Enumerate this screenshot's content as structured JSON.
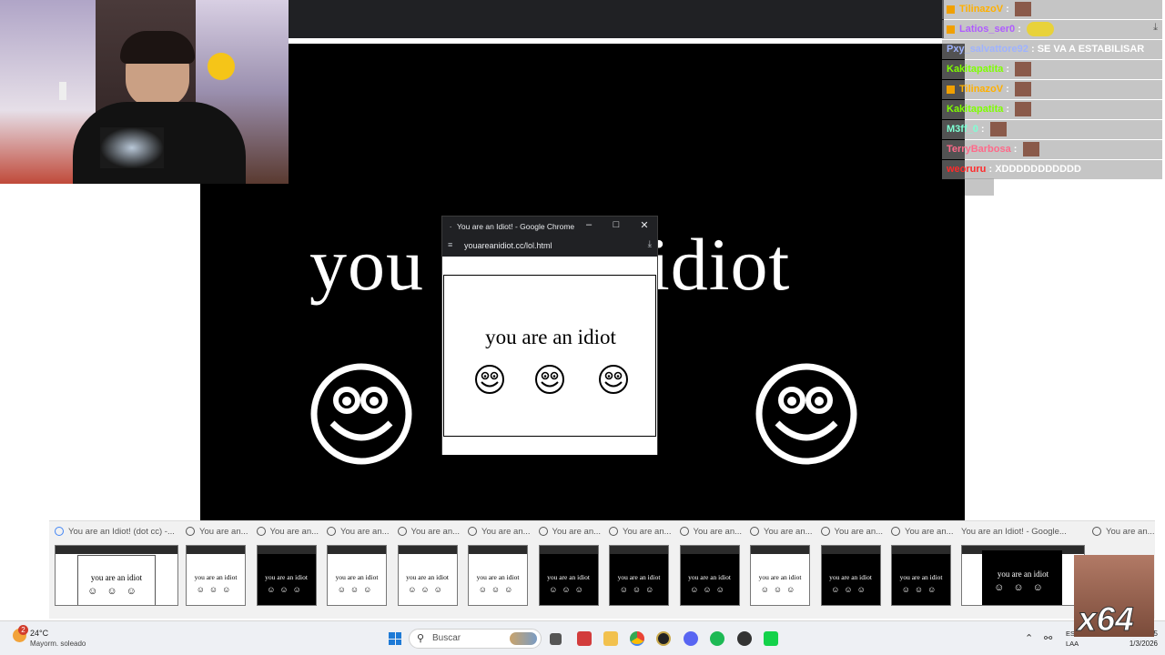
{
  "popup": {
    "title": "You are an Idiot! - Google Chrome",
    "url": "youareanidiot.cc/lol.html",
    "page_text": "you are an idiot"
  },
  "background": {
    "big_text": "you are an idiot"
  },
  "chat": {
    "messages": [
      {
        "user": "TilinazoV",
        "color": "#ffb000",
        "badge": true,
        "message": "",
        "emote": true
      },
      {
        "user": "Latios_ser0",
        "color": "#b05cff",
        "badge": true,
        "message": "",
        "emote": true
      },
      {
        "user": "Pxy_salvattore92",
        "color": "#9fb3ff",
        "badge": false,
        "message": "SE VA A ESTABILISAR",
        "emote": false
      },
      {
        "user": "Kakitapatita",
        "color": "#7fff00",
        "badge": false,
        "message": "",
        "emote": true
      },
      {
        "user": "TilinazoV",
        "color": "#ffb000",
        "badge": true,
        "message": "",
        "emote": true
      },
      {
        "user": "Kakitapatita",
        "color": "#7fff00",
        "badge": false,
        "message": "",
        "emote": true
      },
      {
        "user": "M3ff_0",
        "color": "#7fffd4",
        "badge": false,
        "message": "",
        "emote": true
      },
      {
        "user": "TerryBarbosa",
        "color": "#ff6a8a",
        "badge": false,
        "message": "",
        "emote": true
      },
      {
        "user": "weoruru",
        "color": "#ff2a2a",
        "badge": false,
        "message": "XDDDDDDDDDDD",
        "emote": false
      }
    ]
  },
  "thumbnails": {
    "first_label": "You are an Idiot! (dot cc) -...",
    "items": [
      {
        "label": "You are an...",
        "theme": "light",
        "text": "you are an idiot"
      },
      {
        "label": "You are an...",
        "theme": "dark",
        "text": "you are an idiot"
      },
      {
        "label": "You are an...",
        "theme": "light",
        "text": "you are an idiot"
      },
      {
        "label": "You are an...",
        "theme": "light",
        "text": "you are an idiot"
      },
      {
        "label": "You are an...",
        "theme": "light",
        "text": "you are an idiot"
      },
      {
        "label": "You are an...",
        "theme": "dark",
        "text": "you are an idiot"
      },
      {
        "label": "You are an...",
        "theme": "dark",
        "text": "you are an idiot"
      },
      {
        "label": "You are an...",
        "theme": "dark",
        "text": "you are an idiot"
      },
      {
        "label": "You are an...",
        "theme": "light",
        "text": "you are an idiot"
      },
      {
        "label": "You are an...",
        "theme": "dark",
        "text": "you are an idiot"
      },
      {
        "label": "You are an...",
        "theme": "dark",
        "text": "you are an idiot"
      }
    ],
    "wide_label": "You are an Idiot! - Google...",
    "last_label": "You are an...",
    "first_text": "you are an idiot",
    "wide_text": "you are an idiot"
  },
  "taskbar": {
    "weather_temp": "24°C",
    "weather_desc": "Mayorm. soleado",
    "notif_count": "2",
    "search_label": "Buscar",
    "lang_line1": "ESP",
    "lang_line2": "LAA",
    "time": "21:35",
    "date": "1/3/2026"
  },
  "overlay": {
    "emote_count": "x64"
  }
}
